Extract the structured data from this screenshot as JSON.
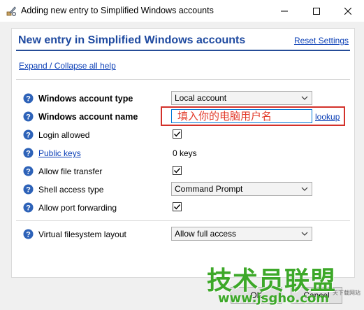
{
  "window": {
    "title": "Adding new entry to Simplified Windows accounts",
    "icon": "tools-icon",
    "controls": [
      "minimize",
      "maximize",
      "close"
    ]
  },
  "panel": {
    "title": "New entry in Simplified Windows accounts",
    "reset_label": "Reset Settings",
    "expand_label": "Expand / Collapse all help"
  },
  "fields": {
    "account_type": {
      "label": "Windows account type",
      "value": "Local account"
    },
    "account_name": {
      "label": "Windows account name",
      "value": "填入你的电脑用户名",
      "lookup_label": "lookup"
    },
    "login_allowed": {
      "label": "Login allowed",
      "checked": true
    },
    "public_keys": {
      "label": "Public keys",
      "value": "0 keys"
    },
    "file_transfer": {
      "label": "Allow file transfer",
      "checked": true
    },
    "shell_access": {
      "label": "Shell access type",
      "value": "Command Prompt"
    },
    "port_forwarding": {
      "label": "Allow port forwarding",
      "checked": true
    },
    "vfs_layout": {
      "label": "Virtual filesystem layout",
      "value": "Allow full access"
    }
  },
  "buttons": {
    "ok": "OK",
    "cancel": "Cancel"
  },
  "watermark": {
    "main": "技术员联盟",
    "url": "www.jsgho.com",
    "small": "天下载网站"
  },
  "colors": {
    "title_blue": "#1f4aa0",
    "link_blue": "#0b3fb6",
    "highlight_red": "#d3312a",
    "watermark_green": "#3da829"
  }
}
